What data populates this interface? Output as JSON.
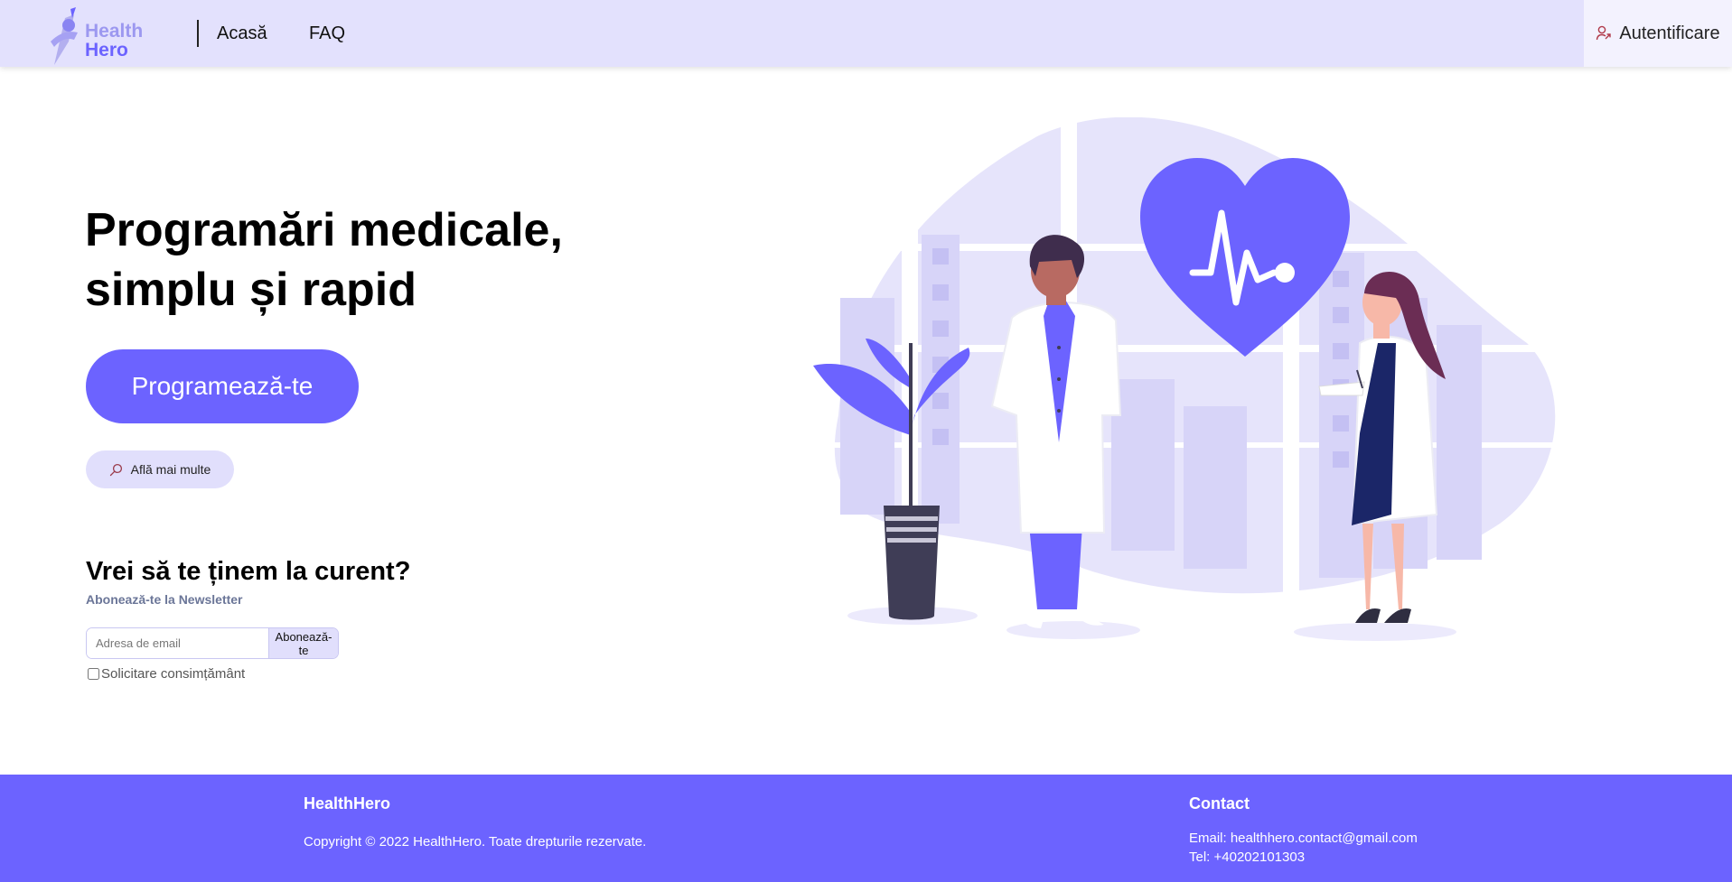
{
  "brand": {
    "line1": "Health",
    "line2": "Hero"
  },
  "nav": {
    "home": "Acasă",
    "faq": "FAQ",
    "login": "Autentificare"
  },
  "hero": {
    "title_line1": "Programări medicale,",
    "title_line2": "simplu și rapid",
    "cta_label": "Programează-te",
    "more_label": "Află mai multe"
  },
  "newsletter": {
    "title": "Vrei să te ținem la curent?",
    "subtitle": "Abonează-te la Newsletter",
    "email_placeholder": "Adresa de email",
    "email_value": "",
    "subscribe_label": "Abonează-te",
    "consent_label": "Solicitare consimțământ",
    "consent_checked": false
  },
  "footer": {
    "brand": "HealthHero",
    "copyright": "Copyright © 2022 HealthHero. Toate drepturile rezervate.",
    "contact_title": "Contact",
    "email": "Email: healthhero.contact@gmail.com",
    "phone": "Tel: +40202101303"
  },
  "colors": {
    "accent": "#6c63ff",
    "navbar_bg": "#e3e1fd",
    "light_accent": "#e1dffc",
    "blob": "#e6e4fb",
    "text_dark": "#111111"
  },
  "icons": {
    "logo": "hero-figure-logo-icon",
    "login": "user-icon",
    "more": "search-icon"
  }
}
